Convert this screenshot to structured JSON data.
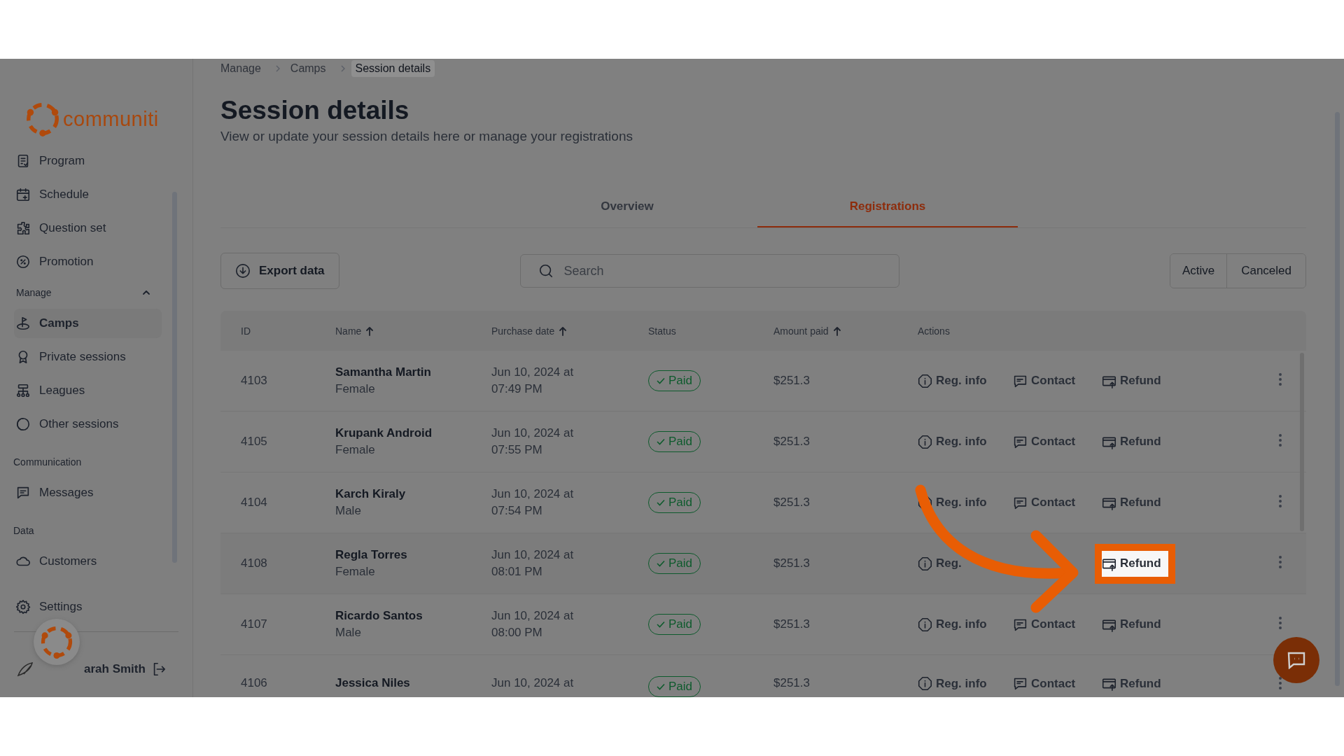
{
  "sidebar": {
    "logo": "communiti",
    "items": [
      {
        "kind": "item",
        "label": "Program",
        "selected": false
      },
      {
        "kind": "item",
        "label": "Schedule",
        "selected": false
      },
      {
        "kind": "item",
        "label": "Question set",
        "selected": false
      },
      {
        "kind": "item",
        "label": "Promotion",
        "selected": false
      },
      {
        "kind": "heading",
        "label": "Manage",
        "expanded": true
      },
      {
        "kind": "item",
        "label": "Camps",
        "selected": true
      },
      {
        "kind": "item",
        "label": "Private sessions",
        "selected": false
      },
      {
        "kind": "item",
        "label": "Leagues",
        "selected": false
      },
      {
        "kind": "item",
        "label": "Other sessions",
        "selected": false
      },
      {
        "kind": "heading",
        "label": "Communication"
      },
      {
        "kind": "item",
        "label": "Messages",
        "selected": false
      },
      {
        "kind": "heading",
        "label": "Data"
      },
      {
        "kind": "item",
        "label": "Customers",
        "selected": false
      }
    ],
    "settings": "Settings",
    "user": "arah Smith"
  },
  "breadcrumbs": [
    {
      "label": "Manage",
      "current": false
    },
    {
      "label": "Camps",
      "current": false
    },
    {
      "label": "Session details",
      "current": true
    }
  ],
  "title": "Session details",
  "subtitle": "View or update your session details here or manage your registrations",
  "tabs": [
    {
      "label": "Overview",
      "selected": false
    },
    {
      "label": "Registrations",
      "selected": true
    }
  ],
  "export_button": "Export data",
  "search": {
    "placeholder": "Search"
  },
  "filters": [
    {
      "label": "Active",
      "selected": false
    },
    {
      "label": "Canceled",
      "selected": false
    }
  ],
  "table": {
    "columns": [
      {
        "label": "ID",
        "sortable": false
      },
      {
        "label": "Name",
        "sortable": true
      },
      {
        "label": "Purchase date",
        "sortable": true
      },
      {
        "label": "Status",
        "sortable": false
      },
      {
        "label": "Amount paid",
        "sortable": true
      },
      {
        "label": "Actions",
        "sortable": false
      }
    ],
    "rows": [
      {
        "id": "4103",
        "name": "Samantha Martin",
        "gender": "Female",
        "purchase_date": [
          "Jun 10, 2024 at",
          "07:49 PM"
        ],
        "status": "Paid",
        "amount": "$251.3",
        "highlighted": false,
        "actions": [
          {
            "kind": "info",
            "label": "Reg. info"
          },
          {
            "kind": "contact",
            "label": "Contact"
          },
          {
            "kind": "refund",
            "label": "Refund"
          }
        ]
      },
      {
        "id": "4105",
        "name": "Krupank Android",
        "gender": "Female",
        "purchase_date": [
          "Jun 10, 2024 at",
          "07:55 PM"
        ],
        "status": "Paid",
        "amount": "$251.3",
        "highlighted": false,
        "actions": [
          {
            "kind": "info",
            "label": "Reg. info"
          },
          {
            "kind": "contact",
            "label": "Contact"
          },
          {
            "kind": "refund",
            "label": "Refund"
          }
        ]
      },
      {
        "id": "4104",
        "name": "Karch Kiraly",
        "gender": "Male",
        "purchase_date": [
          "Jun 10, 2024 at",
          "07:54 PM"
        ],
        "status": "Paid",
        "amount": "$251.3",
        "highlighted": false,
        "actions": [
          {
            "kind": "info",
            "label": "Reg. info"
          },
          {
            "kind": "contact",
            "label": "Contact"
          },
          {
            "kind": "refund",
            "label": "Refund"
          }
        ]
      },
      {
        "id": "4108",
        "name": "Regla Torres",
        "gender": "Female",
        "purchase_date": [
          "Jun 10, 2024 at",
          "08:01 PM"
        ],
        "status": "Paid",
        "amount": "$251.3",
        "highlighted": true,
        "actions": [
          {
            "kind": "info",
            "label": "Reg."
          },
          {
            "kind": "hidden"
          },
          {
            "kind": "refund",
            "label": "Refund"
          }
        ]
      },
      {
        "id": "4107",
        "name": "Ricardo Santos",
        "gender": "Male",
        "purchase_date": [
          "Jun 10, 2024 at",
          "08:00 PM"
        ],
        "status": "Paid",
        "amount": "$251.3",
        "highlighted": false,
        "actions": [
          {
            "kind": "info",
            "label": "Reg. info"
          },
          {
            "kind": "contact",
            "label": "Contact"
          },
          {
            "kind": "refund",
            "label": "Refund"
          }
        ]
      },
      {
        "id": "4106",
        "name": "Jessica Niles",
        "purchase_date": [
          "Jun 10, 2024 at"
        ],
        "status": "Paid",
        "amount": "$251.3",
        "highlighted": false,
        "actions": [
          {
            "kind": "info",
            "label": "Reg. info"
          },
          {
            "kind": "contact",
            "label": "Contact"
          },
          {
            "kind": "refund",
            "label": "Refund"
          }
        ]
      }
    ]
  }
}
